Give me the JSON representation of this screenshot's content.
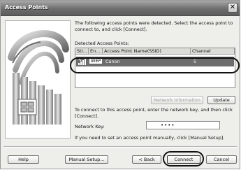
{
  "window": {
    "title": "Access Points",
    "close_glyph": "✕"
  },
  "intro_text": "The following access points were detected. Select the access point to connect to, and click [Connect].",
  "detected_label": "Detected Access Points:",
  "table": {
    "headers": [
      "Str...",
      "En...",
      "Access Point Name(SSID)",
      "Channel"
    ],
    "rows": [
      {
        "strength_icon": "signal-strength-icon",
        "encryption": "WEP",
        "ssid": "Canon",
        "channel": "5"
      }
    ]
  },
  "buttons": {
    "network_info": "Network Information",
    "update": "Update",
    "help": "Help",
    "manual_setup": "Manual Setup...",
    "back": "< Back",
    "connect": "Connect",
    "cancel": "Cancel"
  },
  "connect_instructions": "To connect to this access point, enter the network key, and then click [Connect].",
  "network_key": {
    "label": "Network Key:",
    "value": "••••"
  },
  "manual_text": "If you need to set an access point manually, click [Manual Setup].",
  "colors": {
    "selected_row": "#6d6d6d",
    "titlebar": "#6e6e6e",
    "dialog_bg": "#eeeeea"
  }
}
